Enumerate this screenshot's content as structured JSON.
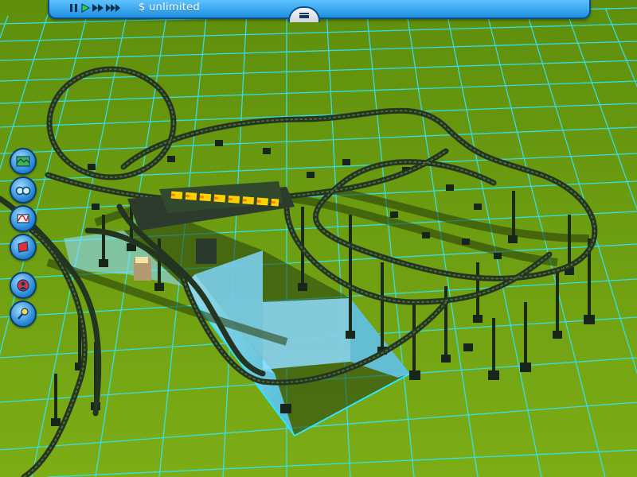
{
  "hud": {
    "money": "$ unlimited"
  },
  "speed_controls": [
    {
      "name": "pause",
      "icon": "pause-icon"
    },
    {
      "name": "play",
      "icon": "play-icon"
    },
    {
      "name": "fast-forward",
      "icon": "fast-forward-icon"
    },
    {
      "name": "fastest",
      "icon": "fastest-icon"
    }
  ],
  "toolbar": [
    {
      "name": "terrain",
      "icon": "terrain-icon"
    },
    {
      "name": "park-guests",
      "icon": "glasses-icon"
    },
    {
      "name": "rides",
      "icon": "ride-icon"
    },
    {
      "name": "scenery",
      "icon": "scenery-icon"
    },
    {
      "name": "staff",
      "icon": "staff-icon"
    },
    {
      "name": "finances",
      "icon": "finance-icon"
    }
  ],
  "colors": {
    "ground": "#6a9a10",
    "grid": "#2ee6ff",
    "track": "#233520",
    "ui_blue": "#1f8fe0"
  }
}
